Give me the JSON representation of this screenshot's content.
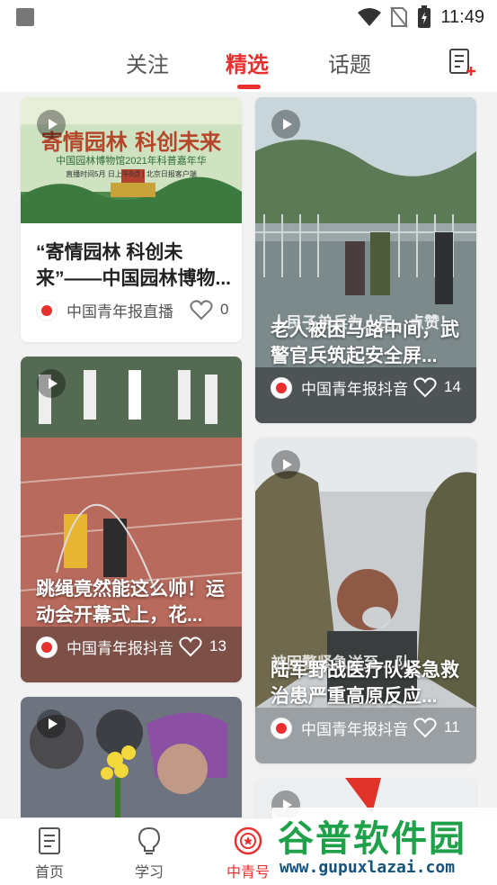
{
  "statusbar": {
    "time": "11:49"
  },
  "tabs": {
    "follow": "关注",
    "featured": "精选",
    "topics": "话题"
  },
  "cards": [
    {
      "title": "“寄情园林 科创未来”——中国园林博物...",
      "source": "中国青年报直播",
      "likes": "0",
      "banner_line1": "寄情园林  科创未来",
      "banner_line2": "中国园林博物馆2021年科普嘉年华",
      "banner_line3": "直播时间5月 日上午9点 | 北京日报客户端"
    },
    {
      "title": "老人被困马路中间，武警官兵筑起安全屏...",
      "source": "中国青年报抖音",
      "likes": "14",
      "overlay_caption": "人民子弟兵为人民，点赞！"
    },
    {
      "title": "跳绳竟然能这么帅！运动会开幕式上，花...",
      "source": "中国青年报抖音",
      "likes": "13"
    },
    {
      "title": "陆军野战医疗队紧急救治患严重高原反应...",
      "source": "中国青年报抖音",
      "likes": "11",
      "overlay_caption": "被困警紧急送至 ...队"
    }
  ],
  "nav": {
    "home": "首页",
    "study": "学习",
    "cyl": "中青号"
  },
  "watermark": {
    "title": "谷普软件园",
    "url": "www.gupuxlazai.com"
  },
  "colors": {
    "accent": "#e8312f"
  }
}
